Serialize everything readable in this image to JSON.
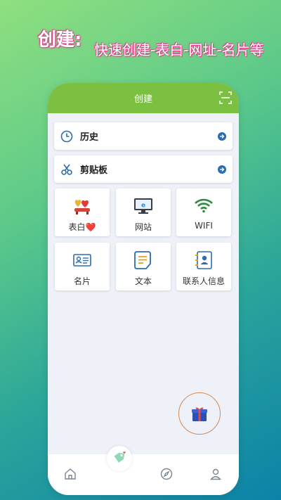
{
  "promo": {
    "title": "创建:",
    "subtitle": "快速创建-表白-网址-名片等"
  },
  "header": {
    "title": "创建",
    "scan_icon": "scan-icon"
  },
  "rows": [
    {
      "label": "历史",
      "icon": "clock-icon"
    },
    {
      "label": "剪贴板",
      "icon": "scissors-icon"
    }
  ],
  "tiles": [
    {
      "label": "表白❤️",
      "icon": "love-icon"
    },
    {
      "label": "网站",
      "icon": "website-icon"
    },
    {
      "label": "WIFI",
      "icon": "wifi-icon"
    },
    {
      "label": "名片",
      "icon": "business-card-icon"
    },
    {
      "label": "文本",
      "icon": "text-icon"
    },
    {
      "label": "联系人信息",
      "icon": "contact-icon"
    }
  ],
  "colors": {
    "header_green": "#7cc041",
    "accent_blue": "#2b6cb0",
    "promo_pink": "#e0408a"
  },
  "tabbar": {
    "items": [
      "home-icon",
      "tag-icon",
      "compass-icon",
      "user-icon"
    ]
  }
}
